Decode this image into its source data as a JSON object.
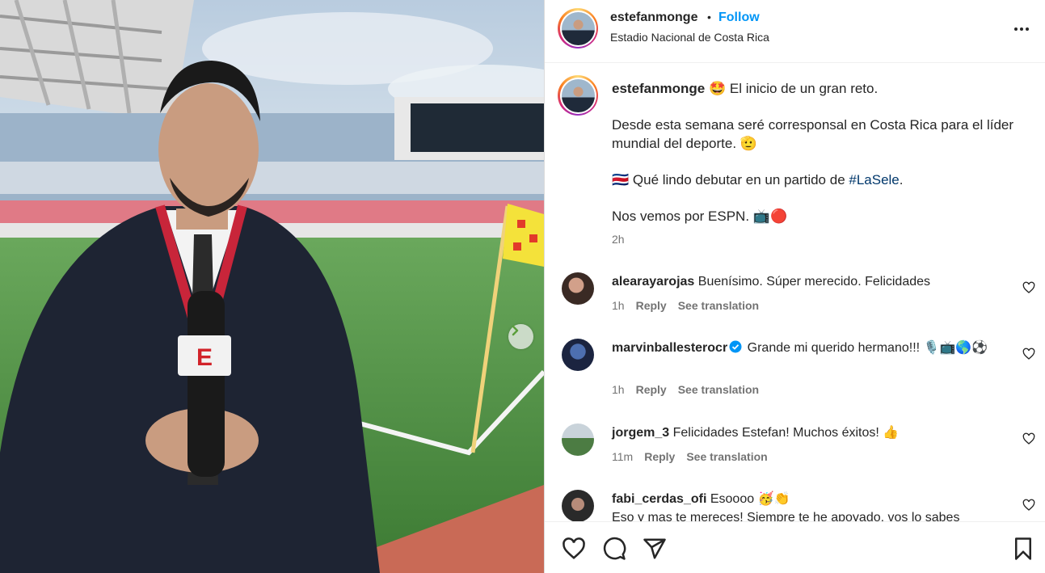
{
  "post": {
    "username": "estefanmonge",
    "dot": "•",
    "follow_label": "Follow",
    "location": "Estadio Nacional de Costa Rica"
  },
  "caption": {
    "username": "estefanmonge",
    "line1": "🤩 El inicio de un gran reto.",
    "line2": "Desde esta semana seré corresponsal en Costa Rica para el líder mundial del deporte. 🫡",
    "line3_before": "🇨🇷 Qué lindo debutar en un partido de ",
    "line3_hashtag": "#LaSele",
    "line3_after": ".",
    "line4": "Nos vemos por ESPN. 📺🔴",
    "time": "2h"
  },
  "comments": [
    {
      "username": "alearayarojas",
      "text": "Buenísimo. Súper merecido. Felicidades",
      "time": "1h",
      "reply": "Reply",
      "translate": "See translation",
      "verified": false
    },
    {
      "username": "marvinballesterocr",
      "text": "Grande mi querido hermano!!! 🎙️📺🌎⚽",
      "time": "1h",
      "reply": "Reply",
      "translate": "See translation",
      "verified": true
    },
    {
      "username": "jorgem_3",
      "text": "Felicidades Estefan! Muchos éxitos! 👍",
      "time": "11m",
      "reply": "Reply",
      "translate": "See translation",
      "verified": false
    },
    {
      "username": "fabi_cerdas_ofi",
      "text": "Esoooo 🥳👏",
      "text2": "Eso y mas te mereces! Siempre te he apoyado, vos lo sabes",
      "verified": false
    }
  ],
  "icons": {
    "more": "more-options-icon",
    "like": "heart-icon",
    "comment": "comment-icon",
    "share": "share-icon",
    "save": "bookmark-icon",
    "next": "chevron-right-icon",
    "verified": "verified-badge-icon"
  },
  "colors": {
    "link_blue": "#0095f6",
    "hashtag": "#00376b",
    "secondary_text": "#737373",
    "verified_blue": "#0095f6"
  }
}
